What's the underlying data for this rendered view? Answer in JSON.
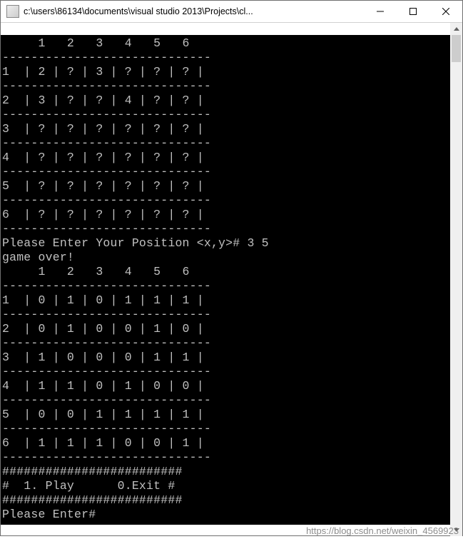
{
  "window": {
    "title": "c:\\users\\86134\\documents\\visual studio 2013\\Projects\\cl..."
  },
  "grid_size": 6,
  "board_columns": [
    "1",
    "2",
    "3",
    "4",
    "5",
    "6"
  ],
  "board_before": [
    {
      "row": "1",
      "cells": [
        "2",
        "?",
        "3",
        "?",
        "?",
        "?"
      ]
    },
    {
      "row": "2",
      "cells": [
        "3",
        "?",
        "?",
        "4",
        "?",
        "?"
      ]
    },
    {
      "row": "3",
      "cells": [
        "?",
        "?",
        "?",
        "?",
        "?",
        "?"
      ]
    },
    {
      "row": "4",
      "cells": [
        "?",
        "?",
        "?",
        "?",
        "?",
        "?"
      ]
    },
    {
      "row": "5",
      "cells": [
        "?",
        "?",
        "?",
        "?",
        "?",
        "?"
      ]
    },
    {
      "row": "6",
      "cells": [
        "?",
        "?",
        "?",
        "?",
        "?",
        "?"
      ]
    }
  ],
  "prompt_position_label": "Please Enter Your Position <x,y># ",
  "prompt_position_input": "3 5",
  "gameover_text": "game over!",
  "board_after": [
    {
      "row": "1",
      "cells": [
        "0",
        "1",
        "0",
        "1",
        "1",
        "1"
      ]
    },
    {
      "row": "2",
      "cells": [
        "0",
        "1",
        "0",
        "0",
        "1",
        "0"
      ]
    },
    {
      "row": "3",
      "cells": [
        "1",
        "0",
        "0",
        "0",
        "1",
        "1"
      ]
    },
    {
      "row": "4",
      "cells": [
        "1",
        "1",
        "0",
        "1",
        "0",
        "0"
      ]
    },
    {
      "row": "5",
      "cells": [
        "0",
        "0",
        "1",
        "1",
        "1",
        "1"
      ]
    },
    {
      "row": "6",
      "cells": [
        "1",
        "1",
        "1",
        "0",
        "0",
        "1"
      ]
    }
  ],
  "menu": {
    "border": "#########################",
    "line": "#  1. Play      0.Exit #"
  },
  "prompt_enter": "Please Enter#",
  "watermark": "https://blog.csdn.net/weixin_4569923"
}
